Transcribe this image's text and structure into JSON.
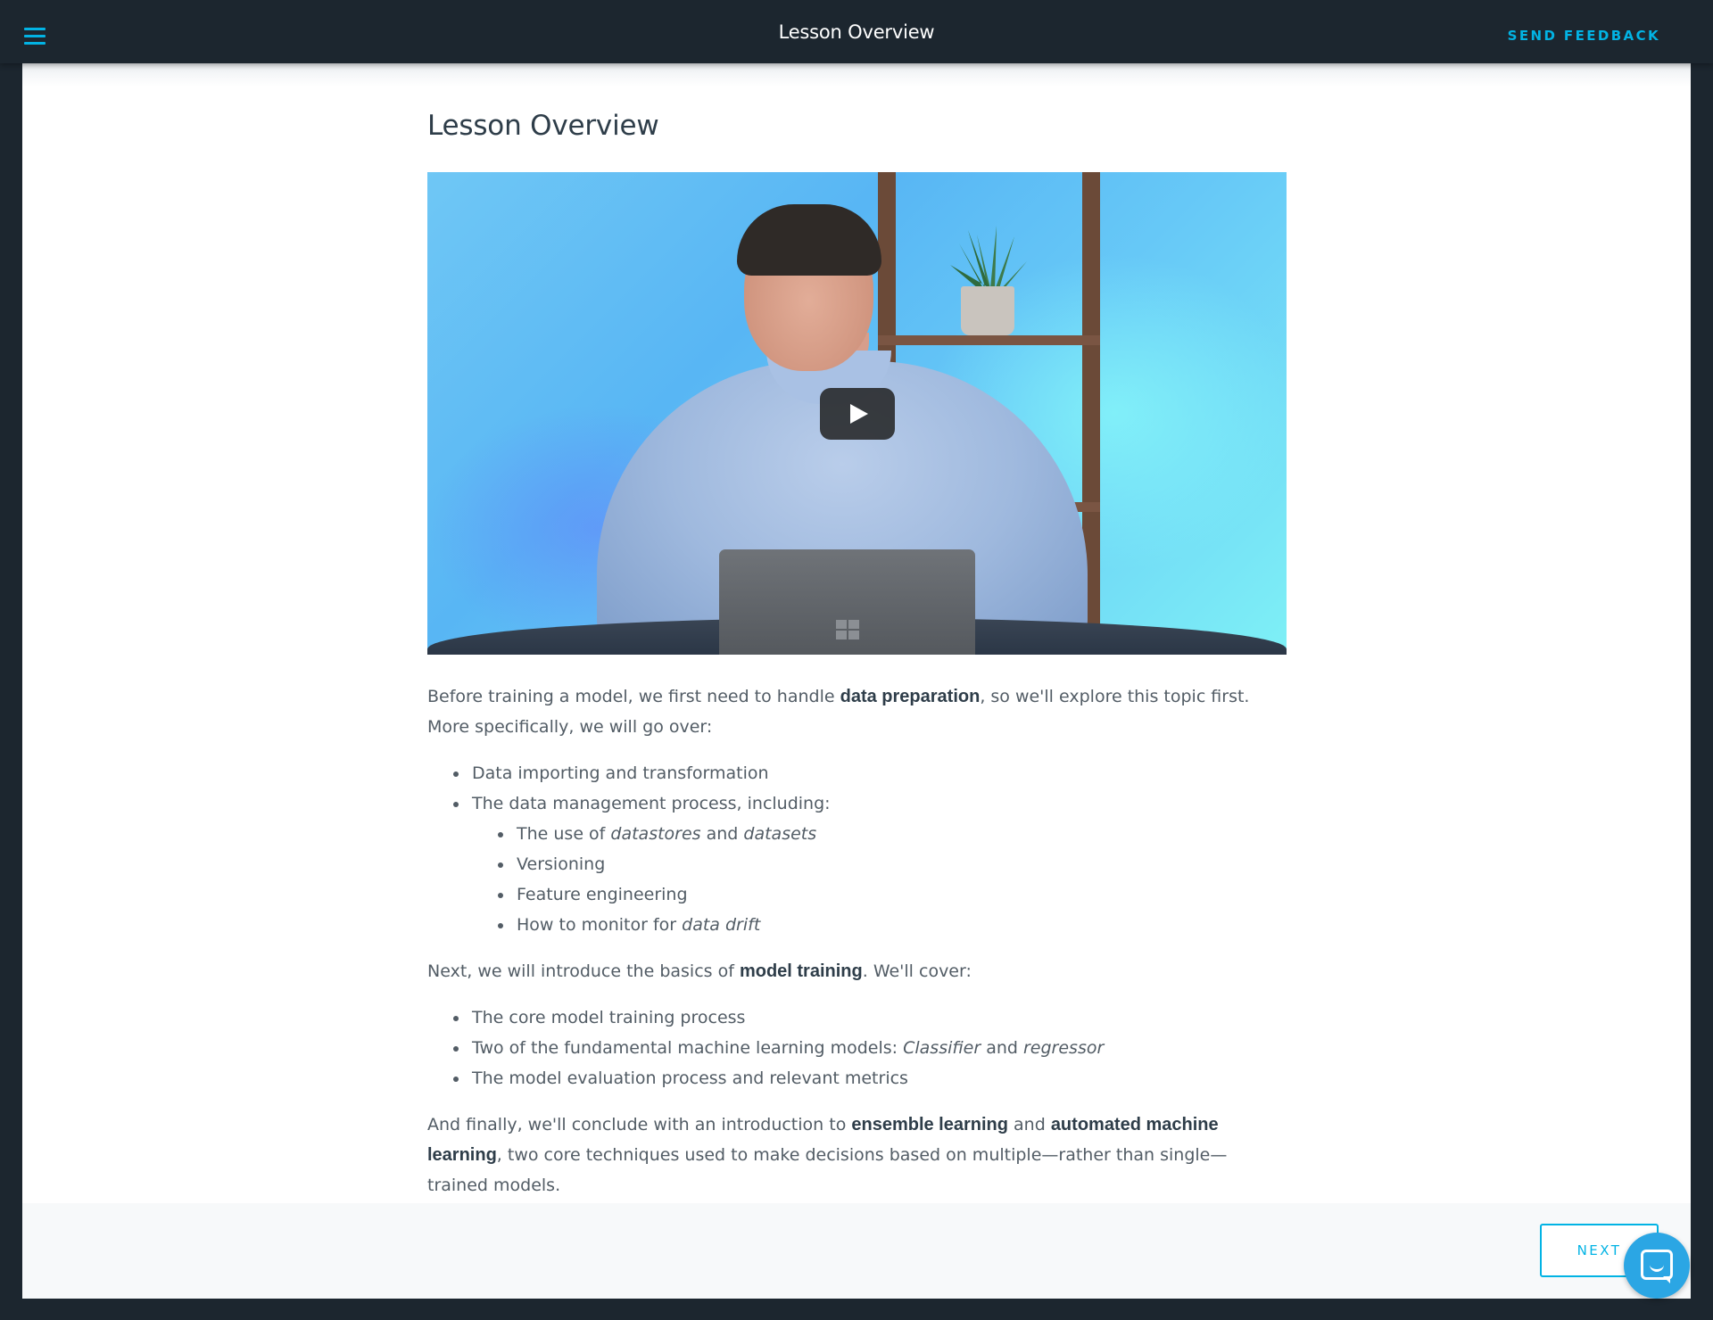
{
  "topbar": {
    "menu_icon": "hamburger-menu-icon",
    "title": "Lesson Overview",
    "feedback_label": "SEND FEEDBACK"
  },
  "colors": {
    "accent": "#02b3e4",
    "topbar_bg": "#1c262f",
    "text": "#525c65",
    "heading": "#2e3d49",
    "chat_bg": "#2ba6e4"
  },
  "lesson": {
    "title": "Lesson Overview",
    "video": {
      "play_icon": "play-icon"
    },
    "intro": {
      "before": "Before training a model, we first need to handle ",
      "bold": "data preparation",
      "after": ", so we'll explore this topic first. More specifically, we will go over:"
    },
    "list1": {
      "item1": "Data importing and transformation",
      "item2": "The data management process, including:",
      "sub": {
        "item1_before": "The use of ",
        "item1_em1": "datastores",
        "item1_mid": " and ",
        "item1_em2": "datasets",
        "item2": "Versioning",
        "item3": "Feature engineering",
        "item4_before": "How to monitor for ",
        "item4_em": "data drift"
      }
    },
    "para2": {
      "before": "Next, we will introduce the basics of ",
      "bold": "model training",
      "after": ". We'll cover:"
    },
    "list2": {
      "item1": "The core model training process",
      "item2_before": "Two of the fundamental machine learning models: ",
      "item2_em1": "Classifier",
      "item2_mid": " and ",
      "item2_em2": "regressor",
      "item3": "The model evaluation process and relevant metrics"
    },
    "para3": {
      "before": "And finally, we'll conclude with an introduction to ",
      "bold1": "ensemble learning",
      "mid": " and ",
      "bold2": "automated machine learning",
      "after": ", two core techniques used to make decisions based on multiple—rather than single—trained models."
    }
  },
  "footer": {
    "next_label": "NEXT",
    "chat_icon": "chat-bubble-icon"
  }
}
